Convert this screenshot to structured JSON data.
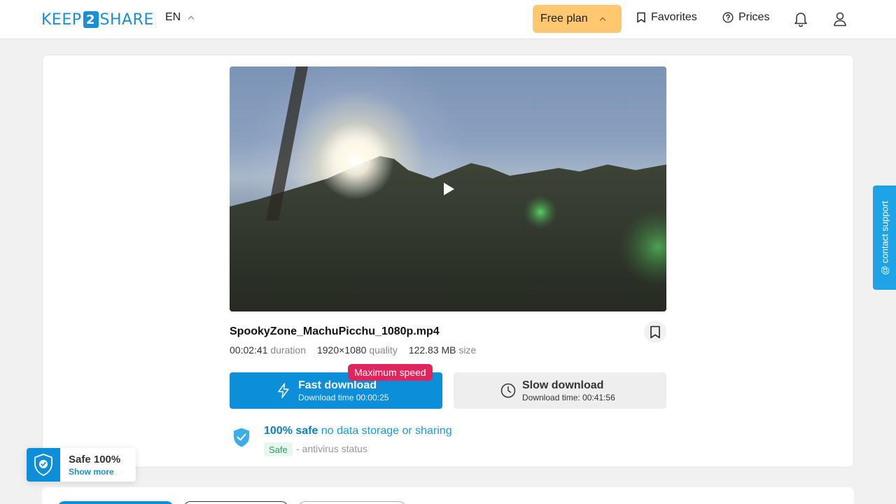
{
  "header": {
    "logo": {
      "left": "KEEP",
      "mid": "2",
      "right": "SHARE"
    },
    "language": "EN",
    "plan_label": "Free plan",
    "favorites_label": "Favorites",
    "prices_label": "Prices",
    "icons": {
      "favorites": "bookmark-icon",
      "prices": "question-circle-icon",
      "notifications": "bell-icon",
      "account": "user-icon"
    }
  },
  "file": {
    "name": "SpookyZone_MachuPicchu_1080p.mp4",
    "duration": "00:02:41",
    "duration_label": "duration",
    "quality": "1920×1080",
    "quality_label": "quality",
    "size": "122.83 MB",
    "size_label": "size"
  },
  "download": {
    "fast_title": "Fast download",
    "fast_sub": "Download time 00:00:25",
    "fast_badge": "Maximum speed",
    "slow_title": "Slow download",
    "slow_sub": "Download time: 00:41:56"
  },
  "safety": {
    "bold": "100% safe",
    "rest": "no data storage or sharing",
    "tag": "Safe",
    "status": "- antivirus status"
  },
  "widget": {
    "title": "Safe 100%",
    "more": "Show more"
  },
  "contact_label": "@ contact support",
  "colors": {
    "brand": "#0c8fd8",
    "plan": "#ffc870",
    "badge": "#e0245e",
    "safe_green": "#2f9a60"
  }
}
